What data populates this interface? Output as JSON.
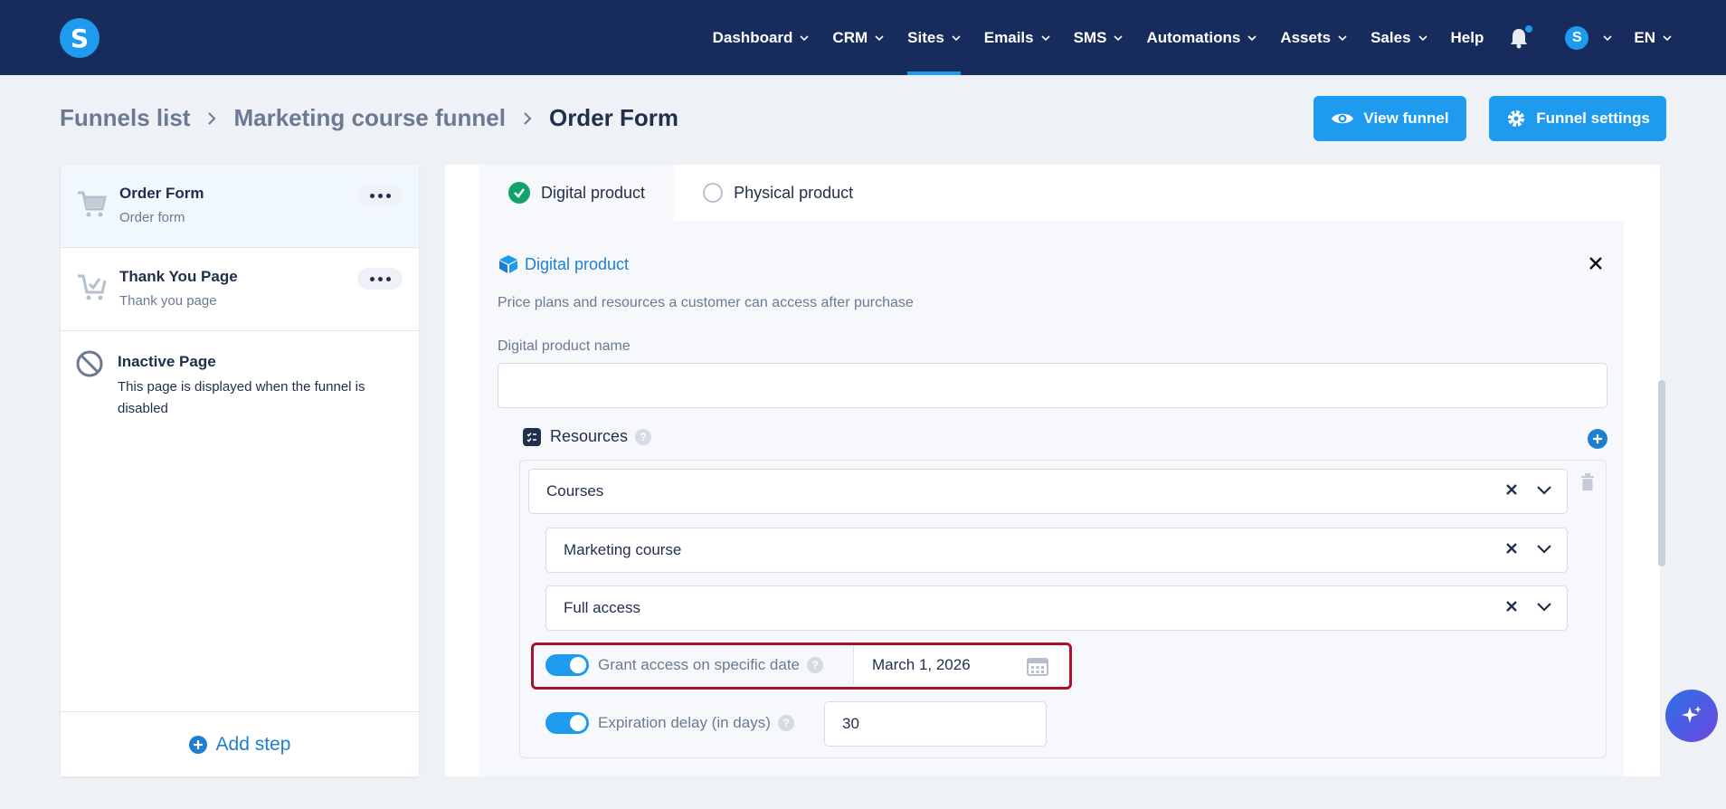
{
  "nav": {
    "items": [
      {
        "label": "Dashboard",
        "dropdown": true,
        "active": false
      },
      {
        "label": "CRM",
        "dropdown": true,
        "active": false
      },
      {
        "label": "Sites",
        "dropdown": true,
        "active": true
      },
      {
        "label": "Emails",
        "dropdown": true,
        "active": false
      },
      {
        "label": "SMS",
        "dropdown": true,
        "active": false
      },
      {
        "label": "Automations",
        "dropdown": true,
        "active": false
      },
      {
        "label": "Assets",
        "dropdown": true,
        "active": false
      },
      {
        "label": "Sales",
        "dropdown": true,
        "active": false
      },
      {
        "label": "Help",
        "dropdown": false,
        "active": false
      }
    ],
    "avatar_letter": "S",
    "language": "EN",
    "logo_letter": "S"
  },
  "breadcrumb": {
    "items": [
      "Funnels list",
      "Marketing course funnel"
    ],
    "current": "Order Form"
  },
  "header_buttons": {
    "view_funnel": "View funnel",
    "funnel_settings": "Funnel settings"
  },
  "steps": [
    {
      "title": "Order Form",
      "subtitle": "Order form",
      "icon": "cart-icon",
      "active": true
    },
    {
      "title": "Thank You Page",
      "subtitle": "Thank you page",
      "icon": "cart-check-icon",
      "active": false
    }
  ],
  "inactive_page": {
    "title": "Inactive Page",
    "description": "This page is displayed when the funnel is disabled"
  },
  "add_step": "Add step",
  "product_tabs": {
    "digital": "Digital product",
    "physical": "Physical product",
    "selected": "digital"
  },
  "digital_product": {
    "heading": "Digital product",
    "description": "Price plans and resources a customer can access after purchase",
    "name_label": "Digital product name",
    "name_value": "",
    "resources_label": "Resources",
    "resource_type": "Courses",
    "course": "Marketing course",
    "access": "Full access",
    "grant_access_label": "Grant access on specific date",
    "grant_access_enabled": true,
    "grant_date": "March 1, 2026",
    "expiration_label": "Expiration delay (in days)",
    "expiration_enabled": true,
    "expiration_days": "30"
  },
  "colors": {
    "nav_bg": "#172b5c",
    "accent": "#1e9bef",
    "highlight": "#a8132a",
    "success": "#12a36b"
  }
}
